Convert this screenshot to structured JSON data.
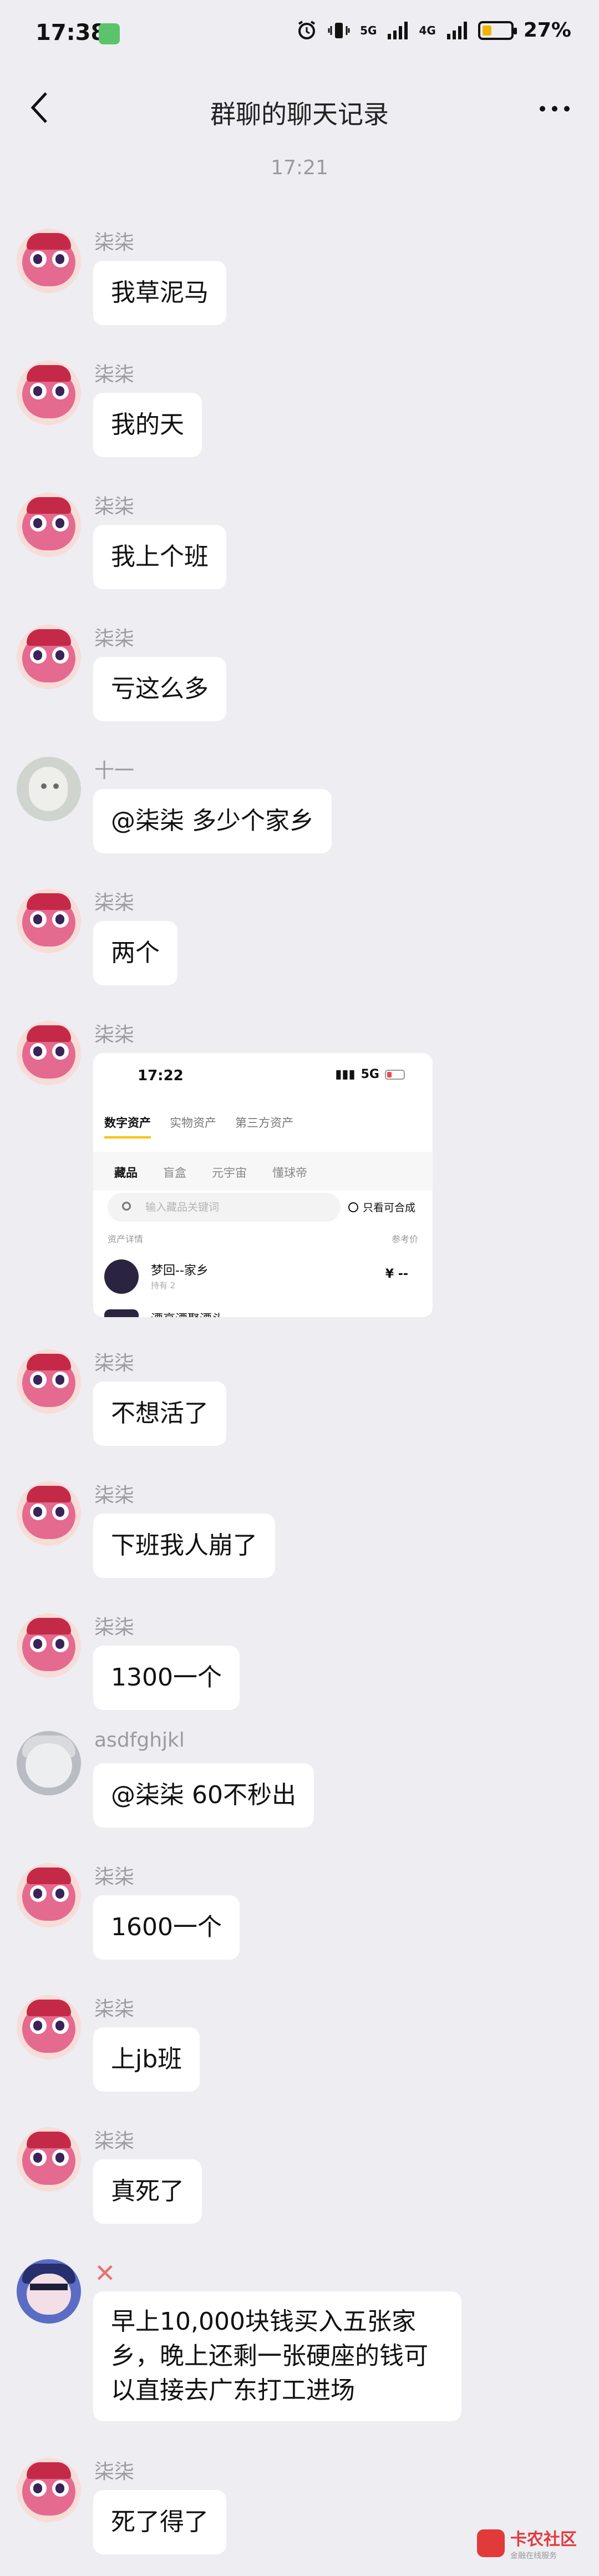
{
  "status_bar": {
    "time": "17:38",
    "network_1": "5G",
    "network_2": "4G",
    "battery": "27%",
    "battery_level": 0.27
  },
  "nav": {
    "title": "群聊的聊天记录"
  },
  "time_divider": "17:21",
  "messages": [
    {
      "sender": "柒柒",
      "text": "我草泥马"
    },
    {
      "sender": "柒柒",
      "text": "我的天"
    },
    {
      "sender": "柒柒",
      "text": "我上个班"
    },
    {
      "sender": "柒柒",
      "text": "亏这么多"
    },
    {
      "sender": "十一",
      "text": "@柒柒 多少个家乡"
    },
    {
      "sender": "柒柒",
      "text": "两个"
    },
    {
      "sender": "柒柒",
      "image": {
        "time": "17:22",
        "network": "5G",
        "tabs": [
          "数字资产",
          "实物资产",
          "第三方资产"
        ],
        "subtabs": [
          "藏品",
          "盲盒",
          "元宇宙",
          "懂球帝"
        ],
        "search_placeholder": "输入藏品关键词",
        "filter_label": "只看可合成",
        "list_header_left": "资产详情",
        "list_header_right": "参考价",
        "item_name": "梦回--家乡",
        "item_meta": "持有 2",
        "item_price": "¥ --",
        "item2_name": "漂亮漂聚漂头"
      }
    },
    {
      "sender": "柒柒",
      "text": "不想活了"
    },
    {
      "sender": "柒柒",
      "text": "下班我人崩了"
    },
    {
      "sender": "柒柒",
      "text": "1300一个"
    },
    {
      "sender": "asdfghjkl",
      "text": "@柒柒 60不秒出"
    },
    {
      "sender": "柒柒",
      "text": "1600一个"
    },
    {
      "sender": "柒柒",
      "text": "上jb班"
    },
    {
      "sender": "柒柒",
      "text": "真死了"
    },
    {
      "sender": "",
      "text": "早上10,000块钱买入五张家乡，晚上还剩一张硬座的钱可以直接去广东打工进场"
    },
    {
      "sender": "柒柒",
      "text": "死了得了"
    }
  ],
  "watermark": {
    "title": "卡农社区",
    "sub": "金融在线服务"
  }
}
